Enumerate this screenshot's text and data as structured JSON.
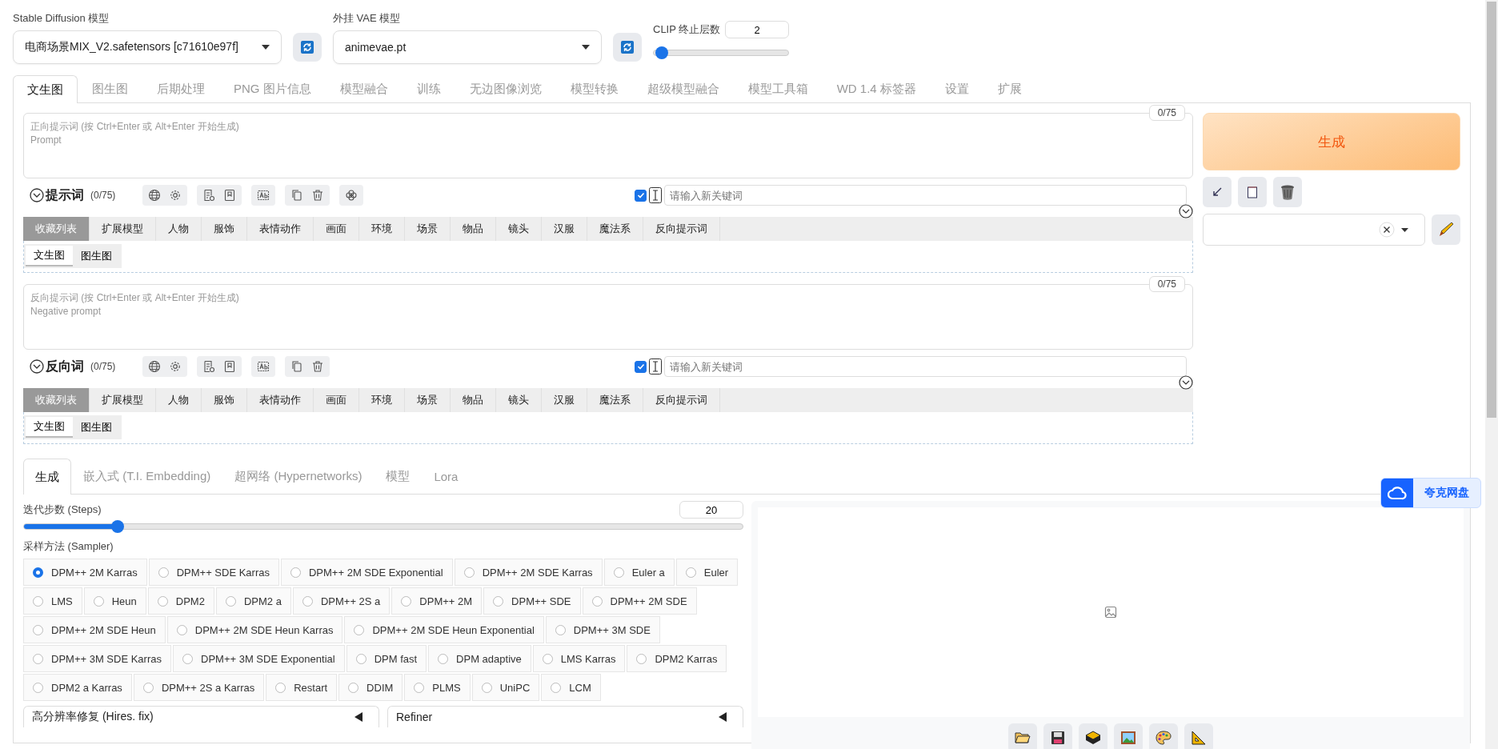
{
  "model_selectors": [
    {
      "label": "Stable Diffusion 模型",
      "value": "电商场景MIX_V2.safetensors [c71610e97f]"
    },
    {
      "label": "外挂 VAE 模型",
      "value": "animevae.pt"
    }
  ],
  "clip_skip": {
    "label": "CLIP 终止层数",
    "value": "2",
    "level": 0.06
  },
  "main_tabs": [
    {
      "label": "文生图",
      "selected": true
    },
    {
      "label": "图生图",
      "selected": false
    },
    {
      "label": "后期处理",
      "selected": false
    },
    {
      "label": "PNG 图片信息",
      "selected": false
    },
    {
      "label": "模型融合",
      "selected": false
    },
    {
      "label": "训练",
      "selected": false
    },
    {
      "label": "无边图像浏览",
      "selected": false
    },
    {
      "label": "模型转换",
      "selected": false
    },
    {
      "label": "超级模型融合",
      "selected": false
    },
    {
      "label": "模型工具箱",
      "selected": false
    },
    {
      "label": "WD 1.4 标签器",
      "selected": false
    },
    {
      "label": "设置",
      "selected": false
    },
    {
      "label": "扩展",
      "selected": false
    }
  ],
  "prompts": [
    {
      "counter": "0/75",
      "placeholder": "正向提示词 (按 Ctrl+Enter 或 Alt+Enter 开始生成)\nPrompt",
      "title": "提示词",
      "count": "(0/75)",
      "extra_tool": true,
      "keyword_checked": true,
      "keyword_placeholder": "请输入新关键词",
      "categories": [
        {
          "label": "收藏列表",
          "selected": true
        },
        {
          "label": "扩展模型",
          "selected": false
        },
        {
          "label": "人物",
          "selected": false
        },
        {
          "label": "服饰",
          "selected": false
        },
        {
          "label": "表情动作",
          "selected": false
        },
        {
          "label": "画面",
          "selected": false
        },
        {
          "label": "环境",
          "selected": false
        },
        {
          "label": "场景",
          "selected": false
        },
        {
          "label": "物品",
          "selected": false
        },
        {
          "label": "镜头",
          "selected": false
        },
        {
          "label": "汉服",
          "selected": false
        },
        {
          "label": "魔法系",
          "selected": false
        },
        {
          "label": "反向提示词",
          "selected": false
        }
      ],
      "subtabs": [
        {
          "label": "文生图",
          "selected": true
        },
        {
          "label": "图生图",
          "selected": false
        }
      ]
    },
    {
      "counter": "0/75",
      "placeholder": "反向提示词 (按 Ctrl+Enter 或 Alt+Enter 开始生成)\nNegative prompt",
      "title": "反向词",
      "count": "(0/75)",
      "extra_tool": false,
      "keyword_checked": true,
      "keyword_placeholder": "请输入新关键词",
      "categories": [
        {
          "label": "收藏列表",
          "selected": true
        },
        {
          "label": "扩展模型",
          "selected": false
        },
        {
          "label": "人物",
          "selected": false
        },
        {
          "label": "服饰",
          "selected": false
        },
        {
          "label": "表情动作",
          "selected": false
        },
        {
          "label": "画面",
          "selected": false
        },
        {
          "label": "环境",
          "selected": false
        },
        {
          "label": "场景",
          "selected": false
        },
        {
          "label": "物品",
          "selected": false
        },
        {
          "label": "镜头",
          "selected": false
        },
        {
          "label": "汉服",
          "selected": false
        },
        {
          "label": "魔法系",
          "selected": false
        },
        {
          "label": "反向提示词",
          "selected": false
        }
      ],
      "subtabs": [
        {
          "label": "文生图",
          "selected": true
        },
        {
          "label": "图生图",
          "selected": false
        }
      ]
    }
  ],
  "generate_button": {
    "label": "生成"
  },
  "lower_tabs": [
    {
      "label": "生成",
      "selected": true
    },
    {
      "label": "嵌入式 (T.I. Embedding)",
      "selected": false
    },
    {
      "label": "超网络 (Hypernetworks)",
      "selected": false
    },
    {
      "label": "模型",
      "selected": false
    },
    {
      "label": "Lora",
      "selected": false
    }
  ],
  "steps": {
    "label": "迭代步数 (Steps)",
    "value": "20",
    "level": 0.13
  },
  "sampler": {
    "label": "采样方法 (Sampler)",
    "options": [
      {
        "label": "DPM++ 2M Karras",
        "selected": true
      },
      {
        "label": "DPM++ SDE Karras",
        "selected": false
      },
      {
        "label": "DPM++ 2M SDE Exponential",
        "selected": false
      },
      {
        "label": "DPM++ 2M SDE Karras",
        "selected": false
      },
      {
        "label": "Euler a",
        "selected": false
      },
      {
        "label": "Euler",
        "selected": false
      },
      {
        "label": "LMS",
        "selected": false
      },
      {
        "label": "Heun",
        "selected": false
      },
      {
        "label": "DPM2",
        "selected": false
      },
      {
        "label": "DPM2 a",
        "selected": false
      },
      {
        "label": "DPM++ 2S a",
        "selected": false
      },
      {
        "label": "DPM++ 2M",
        "selected": false
      },
      {
        "label": "DPM++ SDE",
        "selected": false
      },
      {
        "label": "DPM++ 2M SDE",
        "selected": false
      },
      {
        "label": "DPM++ 2M SDE Heun",
        "selected": false
      },
      {
        "label": "DPM++ 2M SDE Heun Karras",
        "selected": false
      },
      {
        "label": "DPM++ 2M SDE Heun Exponential",
        "selected": false
      },
      {
        "label": "DPM++ 3M SDE",
        "selected": false
      },
      {
        "label": "DPM++ 3M SDE Karras",
        "selected": false
      },
      {
        "label": "DPM++ 3M SDE Exponential",
        "selected": false
      },
      {
        "label": "DPM fast",
        "selected": false
      },
      {
        "label": "DPM adaptive",
        "selected": false
      },
      {
        "label": "LMS Karras",
        "selected": false
      },
      {
        "label": "DPM2 Karras",
        "selected": false
      },
      {
        "label": "DPM2 a Karras",
        "selected": false
      },
      {
        "label": "DPM++ 2S a Karras",
        "selected": false
      },
      {
        "label": "Restart",
        "selected": false
      },
      {
        "label": "DDIM",
        "selected": false
      },
      {
        "label": "PLMS",
        "selected": false
      },
      {
        "label": "UniPC",
        "selected": false
      },
      {
        "label": "LCM",
        "selected": false
      }
    ]
  },
  "accordions": [
    {
      "label": "高分辨率修复 (Hires. fix)"
    },
    {
      "label": "Refiner"
    }
  ],
  "cloud_badge": {
    "label": "夸克网盘"
  }
}
